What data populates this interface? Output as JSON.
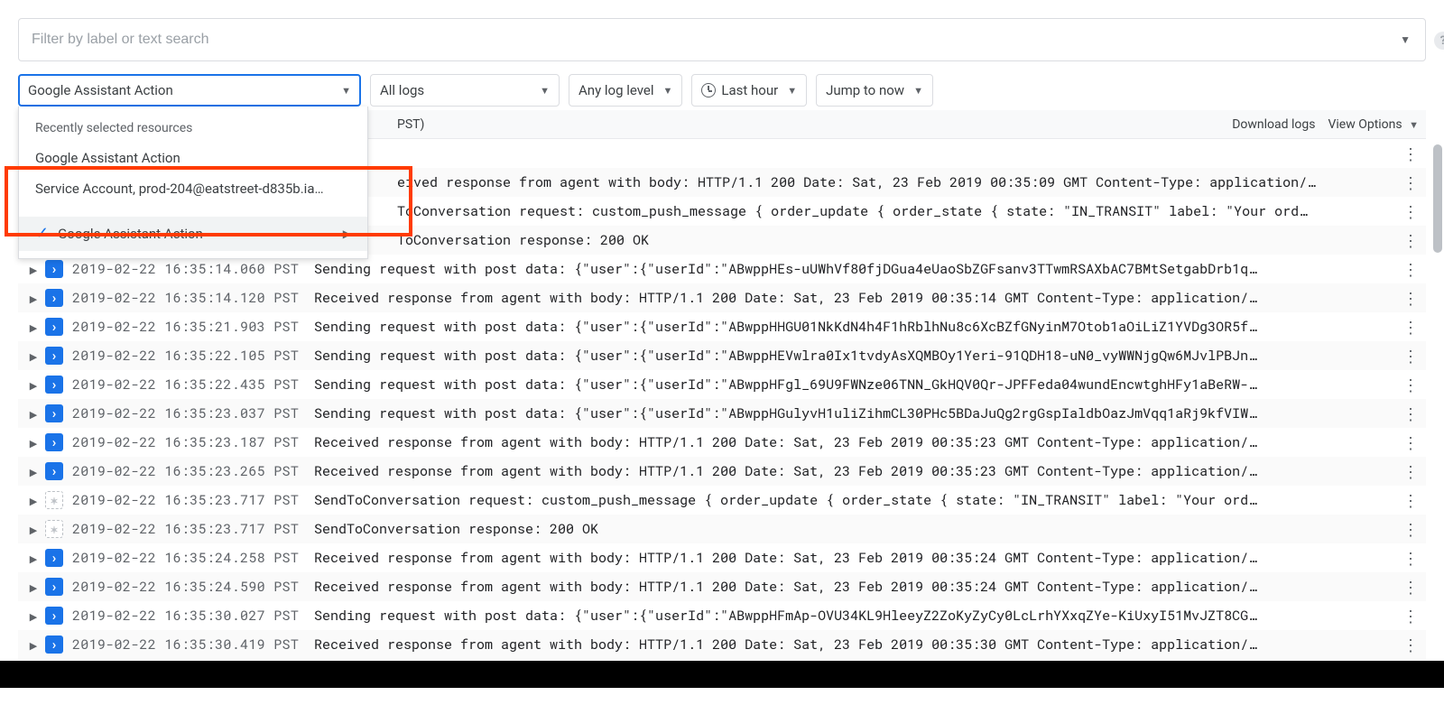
{
  "filter": {
    "placeholder": "Filter by label or text search"
  },
  "controls": {
    "resource": "Google Assistant Action",
    "logs": "All logs",
    "level": "Any log level",
    "time": "Last hour",
    "jump": "Jump to now"
  },
  "dropdown": {
    "section": "Recently selected resources",
    "items": [
      "Google Assistant Action",
      "Service Account, prod-204@eatstreet-d835b.ia…"
    ],
    "selected": "Google Assistant Action"
  },
  "header": {
    "tz_fragment": "PST)",
    "download": "Download logs",
    "view_options": "View Options"
  },
  "rows": [
    {
      "sev": "blue",
      "ts": "",
      "msg": "",
      "noexpand": true,
      "hidden": true
    },
    {
      "sev": "blue",
      "ts": "",
      "msg": "eived response from agent with body: HTTP/1.1 200 Date: Sat, 23 Feb 2019 00:35:09 GMT Content-Type: application/…",
      "noexpand": false,
      "offset": 420
    },
    {
      "sev": "star",
      "ts": "",
      "msg": "ToConversation request: custom_push_message { order_update { order_state { state: \"IN_TRANSIT\" label: \"Your ord…",
      "noexpand": false,
      "offset": 420
    },
    {
      "sev": "star",
      "ts": "",
      "msg": "ToConversation response: 200 OK",
      "noexpand": false,
      "offset": 420
    },
    {
      "sev": "blue",
      "ts": "2019-02-22 16:35:14.060 PST",
      "msg": "Sending request with post data: {\"user\":{\"userId\":\"ABwppHEs-uUWhVf80fjDGua4eUaoSbZGFsanv3TTwmRSAXbAC7BMtSetgabDrb1q…"
    },
    {
      "sev": "blue",
      "ts": "2019-02-22 16:35:14.120 PST",
      "msg": "Received response from agent with body: HTTP/1.1 200 Date: Sat, 23 Feb 2019 00:35:14 GMT Content-Type: application/…"
    },
    {
      "sev": "blue",
      "ts": "2019-02-22 16:35:21.903 PST",
      "msg": "Sending request with post data: {\"user\":{\"userId\":\"ABwppHHGU01NkKdN4h4F1hRblhNu8c6XcBZfGNyinM7Otob1aOiLiZ1YVDg3OR5f…"
    },
    {
      "sev": "blue",
      "ts": "2019-02-22 16:35:22.105 PST",
      "msg": "Sending request with post data: {\"user\":{\"userId\":\"ABwppHEVwlra0Ix1tvdyAsXQMBOy1Yeri-91QDH18-uN0_vyWWNjgQw6MJvlPBJn…"
    },
    {
      "sev": "blue",
      "ts": "2019-02-22 16:35:22.435 PST",
      "msg": "Sending request with post data: {\"user\":{\"userId\":\"ABwppHFgl_69U9FWNze06TNN_GkHQV0Qr-JPFFeda04wundEncwtghHFy1aBeRW-…"
    },
    {
      "sev": "blue",
      "ts": "2019-02-22 16:35:23.037 PST",
      "msg": "Sending request with post data: {\"user\":{\"userId\":\"ABwppHGulyvH1uliZihmCL30PHc5BDaJuQg2rgGspIaldbOazJmVqq1aRj9kfVIW…"
    },
    {
      "sev": "blue",
      "ts": "2019-02-22 16:35:23.187 PST",
      "msg": "Received response from agent with body: HTTP/1.1 200 Date: Sat, 23 Feb 2019 00:35:23 GMT Content-Type: application/…"
    },
    {
      "sev": "blue",
      "ts": "2019-02-22 16:35:23.265 PST",
      "msg": "Received response from agent with body: HTTP/1.1 200 Date: Sat, 23 Feb 2019 00:35:23 GMT Content-Type: application/…"
    },
    {
      "sev": "star",
      "ts": "2019-02-22 16:35:23.717 PST",
      "msg": "SendToConversation request: custom_push_message { order_update { order_state { state: \"IN_TRANSIT\" label: \"Your ord…"
    },
    {
      "sev": "star",
      "ts": "2019-02-22 16:35:23.717 PST",
      "msg": "SendToConversation response: 200 OK"
    },
    {
      "sev": "blue",
      "ts": "2019-02-22 16:35:24.258 PST",
      "msg": "Received response from agent with body: HTTP/1.1 200 Date: Sat, 23 Feb 2019 00:35:24 GMT Content-Type: application/…"
    },
    {
      "sev": "blue",
      "ts": "2019-02-22 16:35:24.590 PST",
      "msg": "Received response from agent with body: HTTP/1.1 200 Date: Sat, 23 Feb 2019 00:35:24 GMT Content-Type: application/…"
    },
    {
      "sev": "blue",
      "ts": "2019-02-22 16:35:30.027 PST",
      "msg": "Sending request with post data: {\"user\":{\"userId\":\"ABwppHFmAp-OVU34KL9HleeyZ2ZoKyZyCy0LcLrhYXxqZYe-KiUxyI51MvJZT8CG…"
    },
    {
      "sev": "blue",
      "ts": "2019-02-22 16:35:30.419 PST",
      "msg": "Received response from agent with body: HTTP/1.1 200 Date: Sat, 23 Feb 2019 00:35:30 GMT Content-Type: application/…"
    }
  ]
}
